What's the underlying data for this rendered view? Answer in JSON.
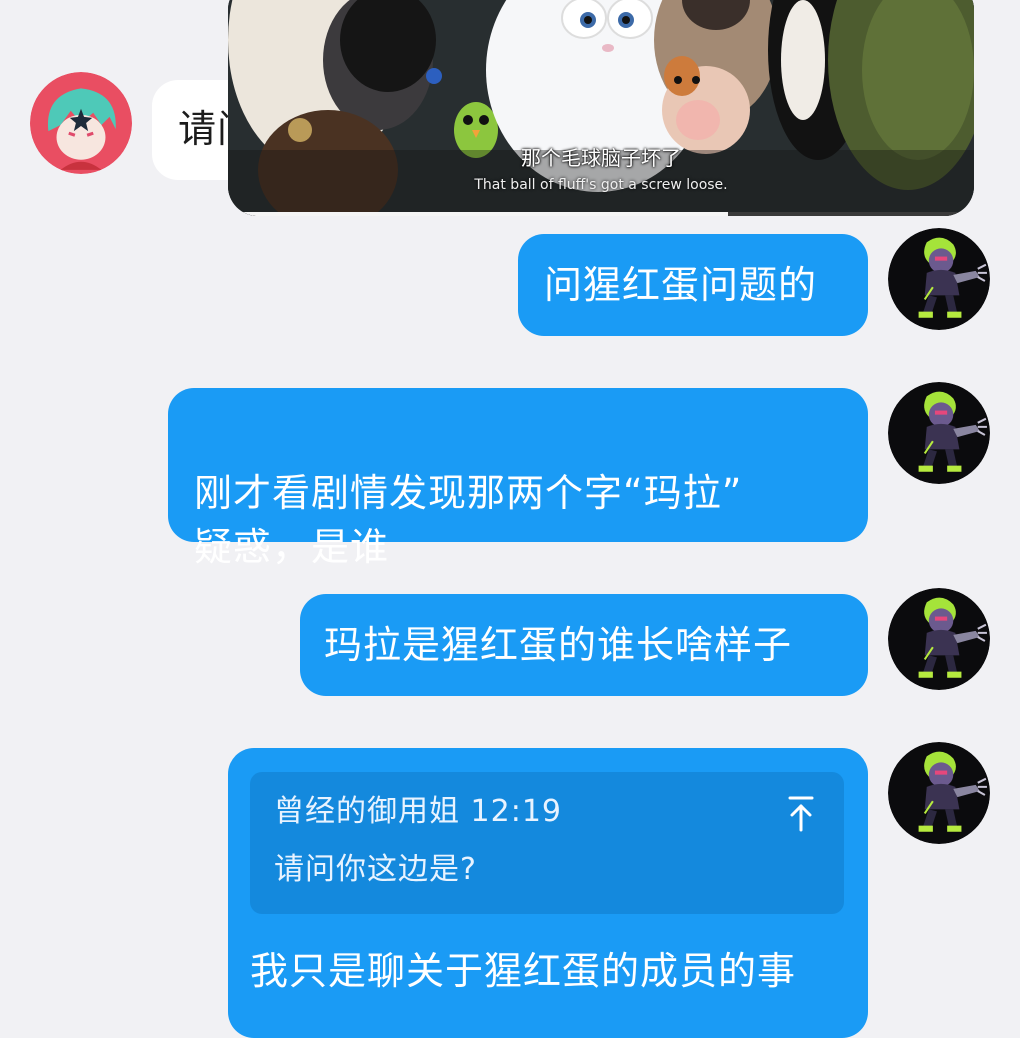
{
  "incoming": {
    "text": "请问你这边是?",
    "avatar_icon": "anime-girl-avatar-icon"
  },
  "video": {
    "subtitle_cn": "那个毛球脑子坏了",
    "subtitle_en": "That ball of fluff's got a screw loose.",
    "progress": 0.67
  },
  "messages": [
    {
      "text": "问猩红蛋问题的"
    },
    {
      "text": "刚才看剧情发现那两个字“玛拉”\n疑惑，是谁"
    },
    {
      "text": "玛拉是猩红蛋的谁长啥样子"
    },
    {
      "text": "我只是聊关于猩红蛋的成员的事"
    }
  ],
  "reply": {
    "author_time": "曾经的御用姐 12:19",
    "quoted_text": "请问你这边是?",
    "jump_icon": "arrow-up-icon"
  },
  "self_avatar_icon": "dark-character-avatar-icon",
  "colors": {
    "bubble_blue": "#1a9bf5",
    "quote_blue": "#1489dd",
    "background": "#f1f1f4"
  }
}
